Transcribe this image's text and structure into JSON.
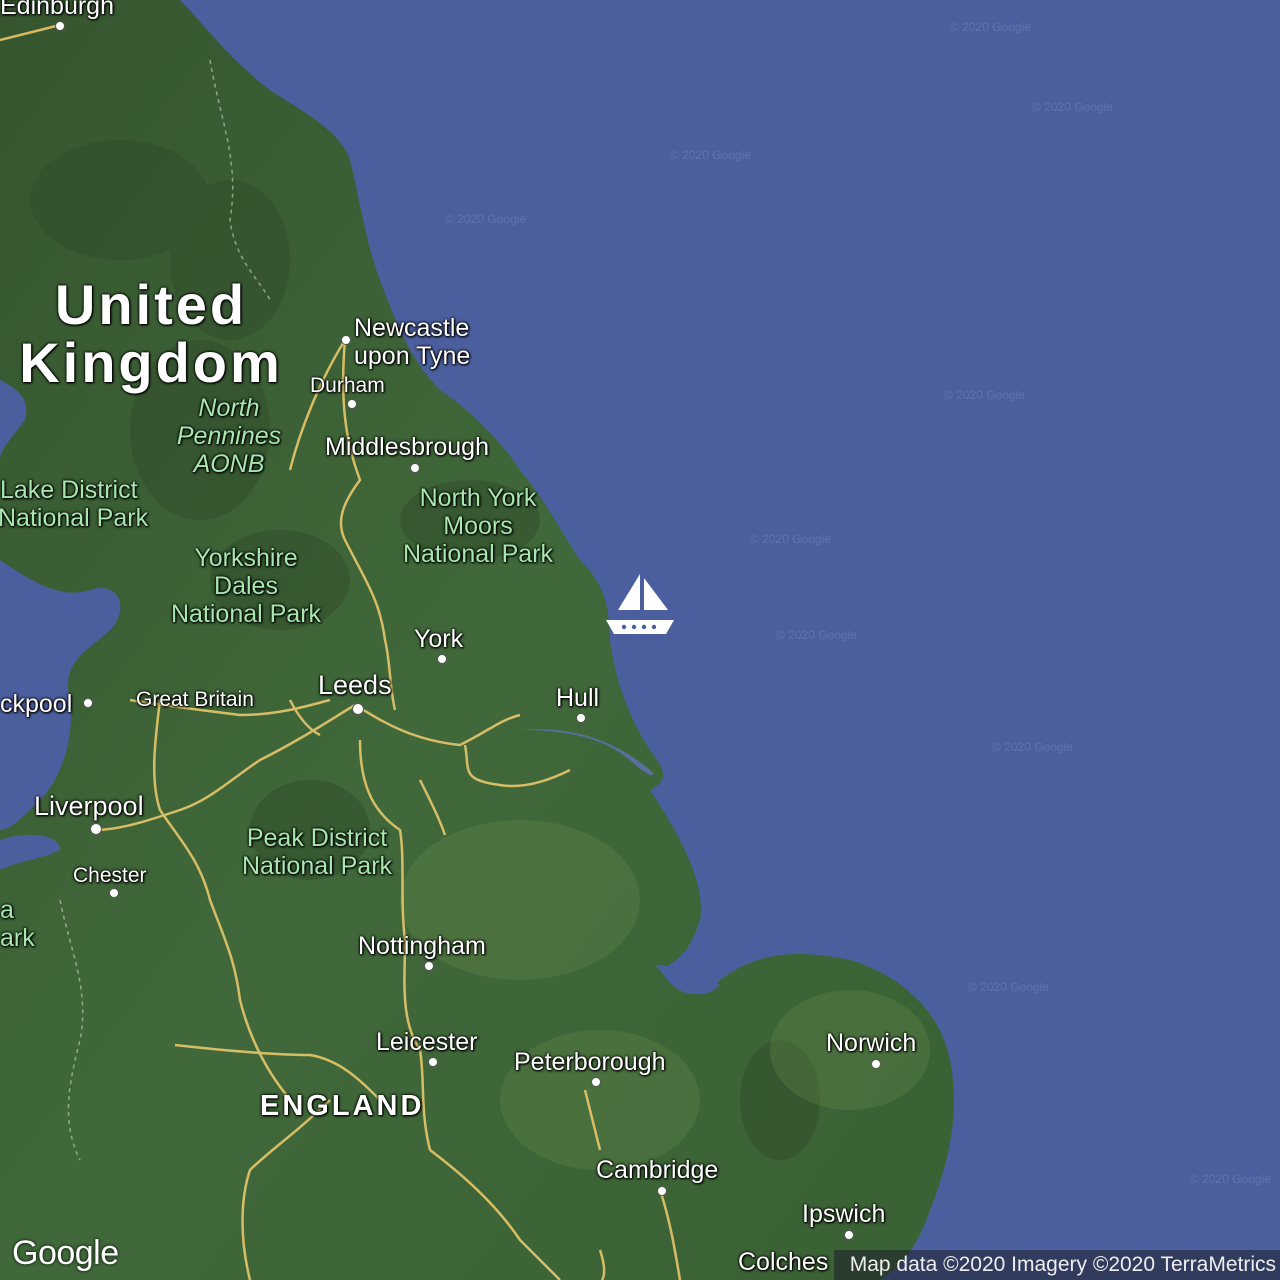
{
  "map": {
    "country_label": [
      "United",
      "Kingdom"
    ],
    "region_label": "ENGLAND",
    "cities": [
      {
        "name": "Edinburgh"
      },
      {
        "name": "Newcastle upon Tyne"
      },
      {
        "name": "Durham"
      },
      {
        "name": "Middlesbrough"
      },
      {
        "name": "York"
      },
      {
        "name": "Leeds"
      },
      {
        "name": "Hull"
      },
      {
        "name": "ckpool"
      },
      {
        "name": "Great Britain"
      },
      {
        "name": "Liverpool"
      },
      {
        "name": "Chester"
      },
      {
        "name": "Nottingham"
      },
      {
        "name": "Leicester"
      },
      {
        "name": "Peterborough"
      },
      {
        "name": "Norwich"
      },
      {
        "name": "Cambridge"
      },
      {
        "name": "Ipswich"
      },
      {
        "name": "Colches"
      }
    ],
    "parks": {
      "north_pennines": [
        "North",
        "Pennines",
        "AONB"
      ],
      "lake_district": [
        "Lake District",
        "National Park"
      ],
      "north_york_moors": [
        "North York",
        "Moors",
        "National Park"
      ],
      "yorkshire_dales": [
        "Yorkshire",
        "Dales",
        "National Park"
      ],
      "peak_district": [
        "Peak District",
        "National Park"
      ],
      "cut_park": [
        "a",
        "ark"
      ]
    },
    "watermark": "© 2020 Google",
    "marker_icon": "sailboat-icon"
  },
  "footer": {
    "logo": "Google",
    "attribution": "Map data ©2020 Imagery ©2020 TerraMetrics"
  },
  "colors": {
    "sea": "#4b5f9e",
    "land": "#3f6438",
    "roads": "#e8c76a",
    "park_text": "#a8e6b0"
  }
}
